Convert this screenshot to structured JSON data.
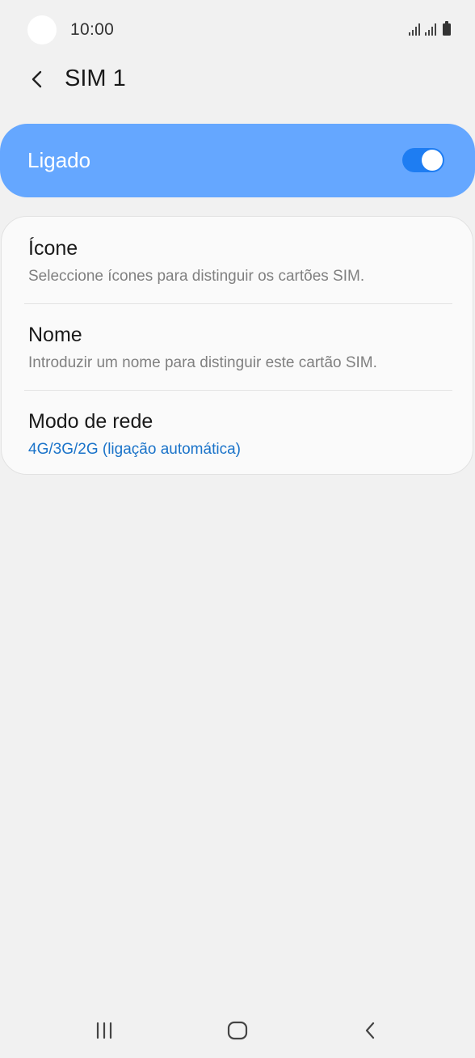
{
  "status_bar": {
    "time": "10:00"
  },
  "header": {
    "title": "SIM 1"
  },
  "master_switch": {
    "label": "Ligado",
    "checked": true,
    "color": "#65a7ff"
  },
  "settings": [
    {
      "title": "Ícone",
      "subtitle": "Seleccione ícones para distinguir os cartões SIM."
    },
    {
      "title": "Nome",
      "subtitle": "Introduzir um nome para distinguir este cartão SIM."
    },
    {
      "title": "Modo de rede",
      "subtitle": "4G/3G/2G (ligação automática)"
    }
  ],
  "icons": {
    "back": "chevron-left-icon",
    "nav_recents": "recents-icon",
    "nav_home": "home-icon",
    "nav_back": "back-icon"
  },
  "colors": {
    "background": "#f1f1f1",
    "accent": "#1a73c9",
    "toggle_track": "#1e7df2"
  }
}
